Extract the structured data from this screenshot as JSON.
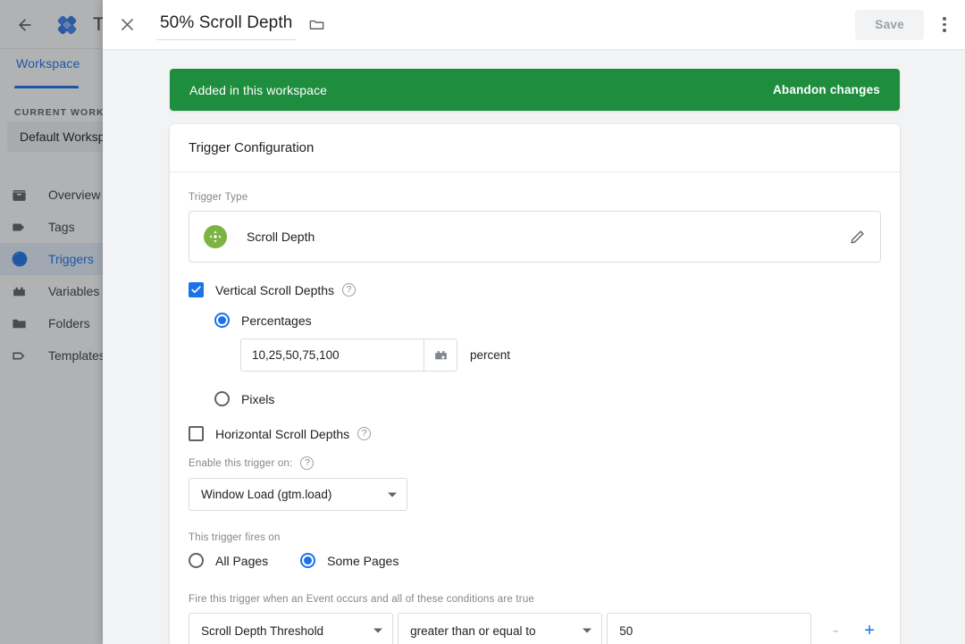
{
  "app": {
    "back_icon": "back-arrow-icon",
    "logo_icon": "google-tag-manager-logo",
    "title": "Tag",
    "tab_workspace": "Workspace"
  },
  "sidebar": {
    "current_workspace_label": "CURRENT WORKSPACE",
    "current_workspace_value": "Default Workspace",
    "items": [
      {
        "label": "Overview",
        "icon": "overview-icon",
        "active": false
      },
      {
        "label": "Tags",
        "icon": "tag-icon",
        "active": false
      },
      {
        "label": "Triggers",
        "icon": "trigger-icon",
        "active": true
      },
      {
        "label": "Variables",
        "icon": "variable-icon",
        "active": false
      },
      {
        "label": "Folders",
        "icon": "folder-icon",
        "active": false
      },
      {
        "label": "Templates",
        "icon": "template-icon",
        "active": false
      }
    ]
  },
  "modal": {
    "close_icon": "close-icon",
    "title": "50% Scroll Depth",
    "folder_icon": "folder-icon",
    "save_label": "Save",
    "menu_icon": "more-vert-icon"
  },
  "banner": {
    "message": "Added in this workspace",
    "action": "Abandon changes",
    "color": "#1e8e3e"
  },
  "card": {
    "heading": "Trigger Configuration",
    "trigger_type_label": "Trigger Type",
    "trigger_type_name": "Scroll Depth",
    "trigger_type_icon": "scroll-depth-icon",
    "trigger_type_color": "#7cb342",
    "edit_icon": "pencil-edit-icon",
    "vertical": {
      "label": "Vertical Scroll Depths",
      "checked": true,
      "help_icon": "help-icon",
      "options": [
        {
          "label": "Percentages",
          "selected": true
        },
        {
          "label": "Pixels",
          "selected": false
        }
      ],
      "value": "10,25,50,75,100",
      "variable_picker_icon": "variable-picker-icon",
      "unit": "percent"
    },
    "horizontal": {
      "label": "Horizontal Scroll Depths",
      "checked": false,
      "help_icon": "help-icon"
    },
    "enable_on": {
      "label": "Enable this trigger on:",
      "help_icon": "help-icon",
      "value": "Window Load (gtm.load)"
    },
    "fires_on": {
      "label": "This trigger fires on",
      "options": [
        {
          "label": "All Pages",
          "selected": false
        },
        {
          "label": "Some Pages",
          "selected": true
        }
      ]
    },
    "conditions": {
      "label": "Fire this trigger when an Event occurs and all of these conditions are true",
      "variable": "Scroll Depth Threshold",
      "operator": "greater than or equal to",
      "value": "50",
      "remove_label": "-",
      "add_label": "+"
    }
  }
}
